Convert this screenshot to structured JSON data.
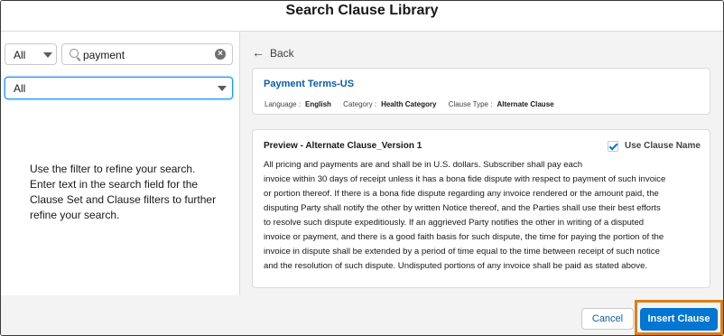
{
  "dialog": {
    "title": "Search Clause Library"
  },
  "filters": {
    "clause_set_select": {
      "value": "All"
    },
    "search": {
      "value": "payment"
    },
    "clause_select": {
      "value": "All"
    },
    "hint": "Use the filter to refine your search. Enter text in the search field for the Clause Set and Clause filters to further refine your search."
  },
  "detail": {
    "back_label": "Back",
    "clause_name": "Payment Terms-US",
    "meta": {
      "language_label": "Language :",
      "language": "English",
      "category_label": "Category :",
      "category": "Health Category",
      "type_label": "Clause Type :",
      "type": "Alternate Clause"
    },
    "preview": {
      "title": "Preview - Alternate Clause_Version 1",
      "use_clause_name_label": "Use Clause Name",
      "use_clause_name_checked": true,
      "lines": [
        "All pricing and payments are and shall be in U.S. dollars. Subscriber shall pay each",
        "invoice within 30 days of receipt unless it has a bona fide dispute with respect to payment of such invoice",
        "or portion thereof. If there is a bona fide dispute regarding any invoice rendered or the amount paid, the",
        "disputing Party shall notify the other by written Notice thereof, and the Parties shall use their best efforts",
        "to resolve such dispute expeditiously. If an aggrieved Party notifies the other in writing of a disputed",
        "invoice or payment, and there is a good faith basis for such dispute, the time for paying the portion of the",
        "invoice in dispute shall be extended by a period of time equal to the time between receipt of such notice",
        "and the resolution of such dispute. Undisputed portions of any invoice shall be paid as stated above."
      ]
    }
  },
  "footer": {
    "cancel_label": "Cancel",
    "insert_label": "Insert Clause"
  },
  "colors": {
    "brand": "#0176d3",
    "link": "#0b5cab",
    "highlight": "#d9801a"
  },
  "icons": [
    "chevron-down-icon",
    "search-icon",
    "clear-icon",
    "back-arrow-icon",
    "checkbox-checked-icon"
  ]
}
